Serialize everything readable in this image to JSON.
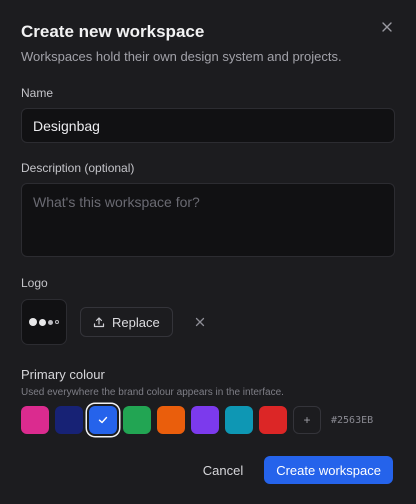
{
  "dialog": {
    "title": "Create new workspace",
    "subtitle": "Workspaces hold their own design system and projects.",
    "close_icon": "close-icon"
  },
  "name_field": {
    "label": "Name",
    "value": "Designbag"
  },
  "description_field": {
    "label": "Description (optional)",
    "placeholder": "What's this workspace for?"
  },
  "logo": {
    "label": "Logo",
    "replace_label": "Replace",
    "replace_icon": "upload-icon",
    "remove_icon": "close-icon"
  },
  "primary_colour": {
    "label": "Primary colour",
    "hint": "Used everywhere the brand colour appears in the interface.",
    "swatches": [
      "#db2b8f",
      "#172275",
      "#2563eb",
      "#22a553",
      "#ea5e0c",
      "#7c3aed",
      "#0e97b4",
      "#dc2626"
    ],
    "selected": "#2563EB",
    "add_label": "+",
    "hex_value": "#2563EB"
  },
  "footer": {
    "cancel_label": "Cancel",
    "create_label": "Create workspace",
    "accent": "#2563eb"
  }
}
